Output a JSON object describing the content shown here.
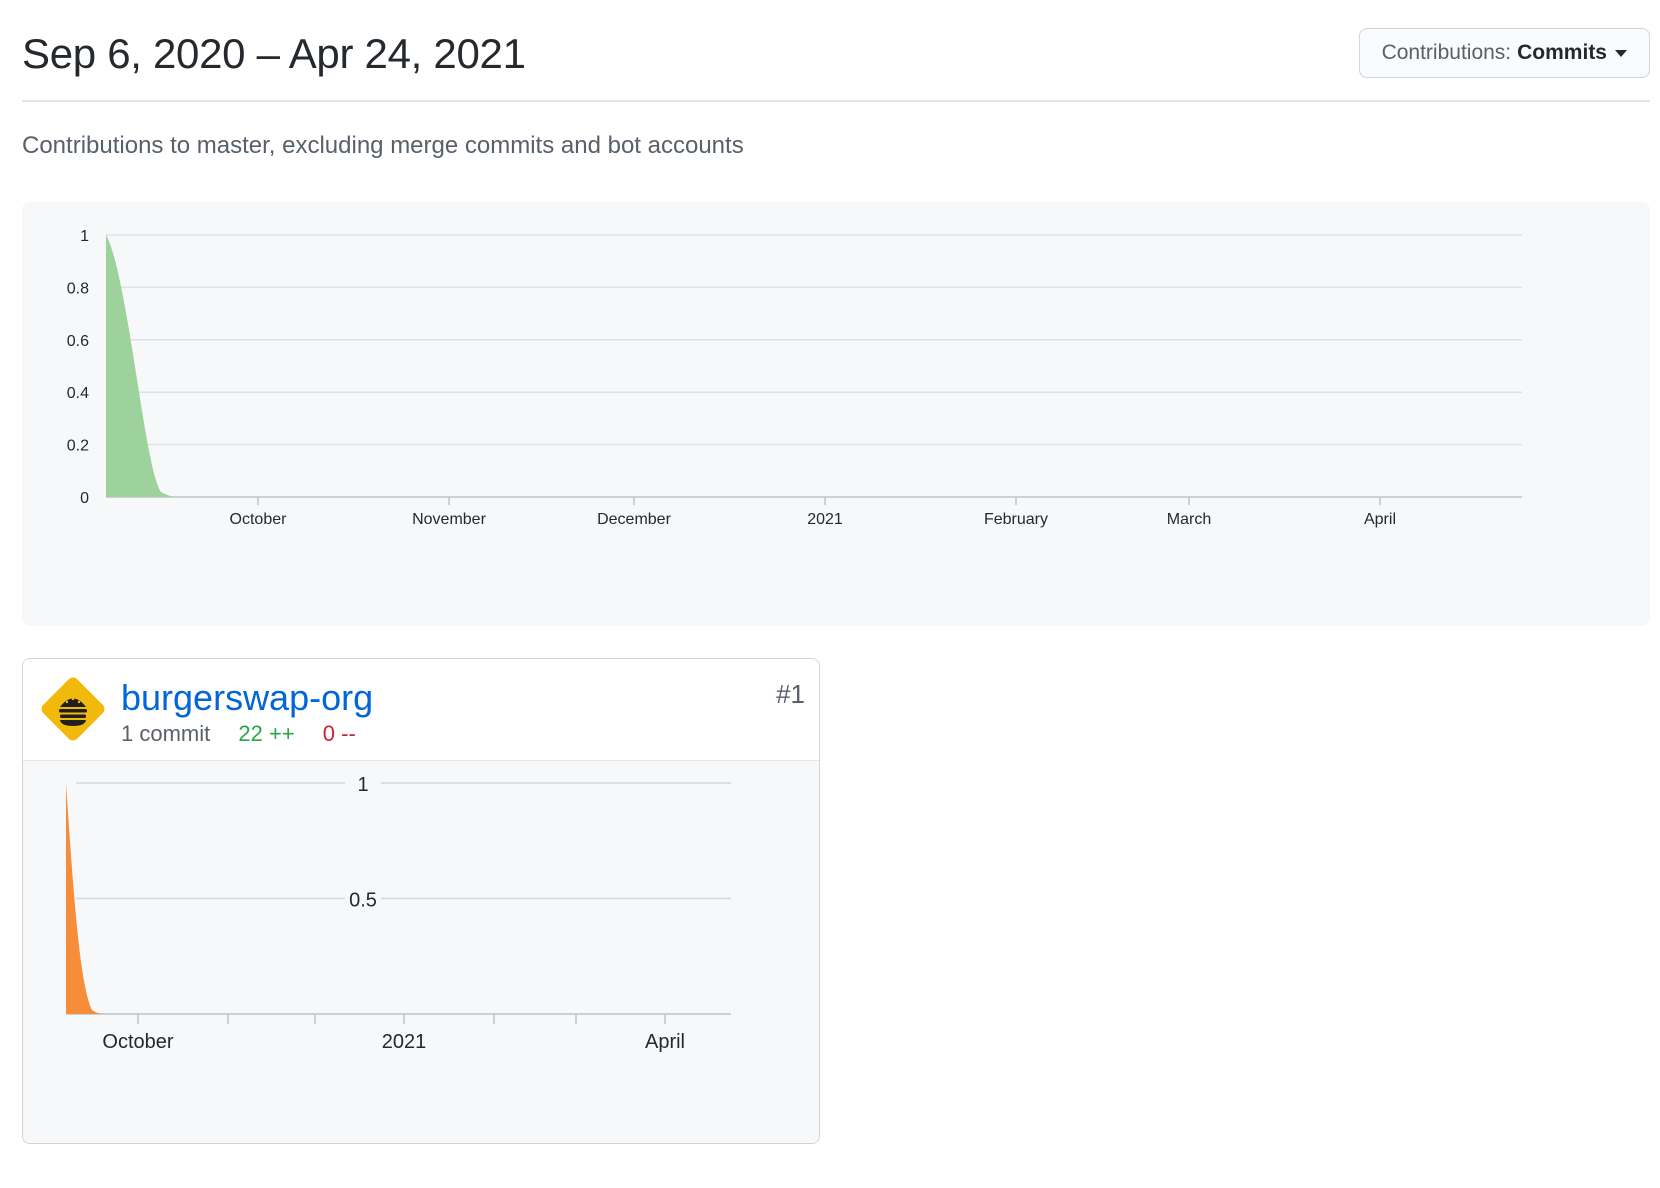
{
  "header": {
    "range_title": "Sep 6, 2020 – Apr 24, 2021",
    "contributions_label": "Contributions:",
    "contributions_value": "Commits"
  },
  "subtitle": "Contributions to master, excluding merge commits and bot accounts",
  "colors": {
    "main_area": "#9ed29c",
    "user_area": "#f68d3a",
    "link": "#0366d6",
    "additions": "#28a745",
    "deletions": "#cb2431"
  },
  "chart_data": [
    {
      "type": "area",
      "x_tick_labels": [
        "October",
        "November",
        "December",
        "2021",
        "February",
        "March",
        "April"
      ],
      "y_ticks": [
        0,
        0.2,
        0.4,
        0.6,
        0.8,
        1
      ],
      "y_tick_labels": [
        "0",
        "0.2",
        "0.4",
        "0.6",
        "0.8",
        "1"
      ],
      "ylim": [
        0,
        1
      ],
      "x_range": [
        "2020-09-06",
        "2021-04-24"
      ],
      "series": [
        {
          "points": [
            [
              "2020-09-06",
              1
            ],
            [
              "2020-09-13",
              0
            ],
            [
              "2021-04-24",
              0
            ]
          ]
        }
      ],
      "grid": true
    },
    {
      "type": "area",
      "x_tick_labels": [
        "October",
        "2021",
        "April"
      ],
      "y_ticks": [
        0.5,
        1
      ],
      "y_tick_labels": [
        "0.5",
        "1"
      ],
      "ylim": [
        0,
        1
      ],
      "x_range": [
        "2020-09-06",
        "2021-04-24"
      ],
      "series": [
        {
          "points": [
            [
              "2020-09-06",
              1
            ],
            [
              "2020-09-13",
              0
            ],
            [
              "2021-04-24",
              0
            ]
          ]
        }
      ],
      "grid": true
    }
  ],
  "contributor": {
    "name": "burgerswap-org",
    "commits": "1 commit",
    "additions": "22 ++",
    "deletions": "0 --",
    "rank": "#1",
    "avatar_icon": "burger-icon"
  }
}
